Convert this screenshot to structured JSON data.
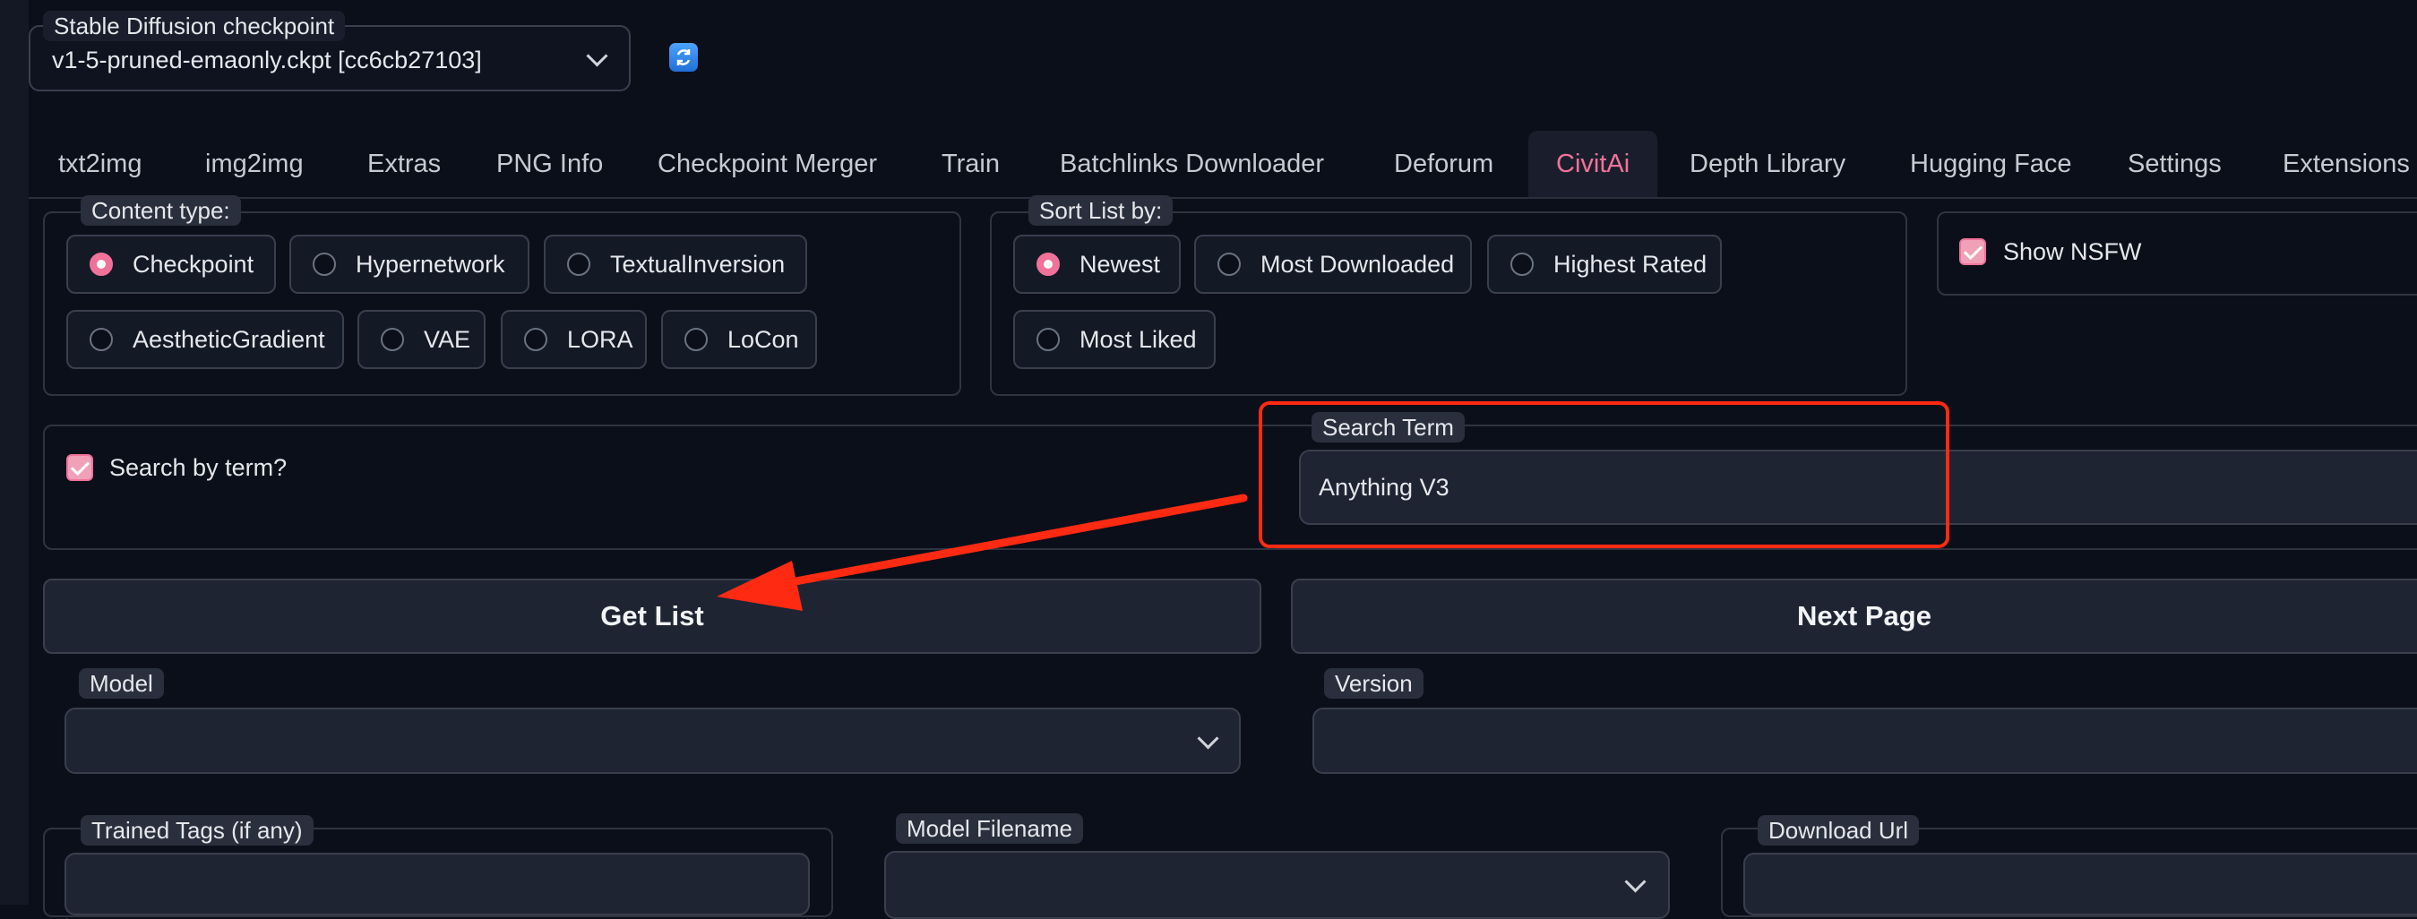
{
  "checkpoint": {
    "label": "Stable Diffusion checkpoint",
    "value": "v1-5-pruned-emaonly.ckpt [cc6cb27103]",
    "refresh_icon": "refresh-icon"
  },
  "tabs": [
    {
      "label": "txt2img"
    },
    {
      "label": "img2img"
    },
    {
      "label": "Extras"
    },
    {
      "label": "PNG Info"
    },
    {
      "label": "Checkpoint Merger"
    },
    {
      "label": "Train"
    },
    {
      "label": "Batchlinks Downloader"
    },
    {
      "label": "Deforum"
    },
    {
      "label": "CivitAi"
    },
    {
      "label": "Depth Library"
    },
    {
      "label": "Hugging Face"
    },
    {
      "label": "Settings"
    },
    {
      "label": "Extensions"
    }
  ],
  "content_type": {
    "label": "Content type:",
    "options": [
      "Checkpoint",
      "Hypernetwork",
      "TextualInversion",
      "AestheticGradient",
      "VAE",
      "LORA",
      "LoCon"
    ],
    "selected": "Checkpoint"
  },
  "sort": {
    "label": "Sort List by:",
    "options": [
      "Newest",
      "Most Downloaded",
      "Highest Rated",
      "Most Liked"
    ],
    "selected": "Newest"
  },
  "nsfw": {
    "label": "Show NSFW",
    "checked": true
  },
  "search_by_term": {
    "label": "Search by term?",
    "checked": true
  },
  "search_term": {
    "label": "Search Term",
    "value": "Anything V3"
  },
  "buttons": {
    "get_list": "Get List",
    "next_page": "Next Page"
  },
  "model": {
    "label": "Model"
  },
  "version": {
    "label": "Version"
  },
  "trained_tags": {
    "label": "Trained Tags (if any)"
  },
  "model_filename": {
    "label": "Model Filename"
  },
  "download_url": {
    "label": "Download Url"
  },
  "colors": {
    "accent": "#f0729a",
    "annotation": "#ff2a12",
    "background": "#0b0f19"
  }
}
